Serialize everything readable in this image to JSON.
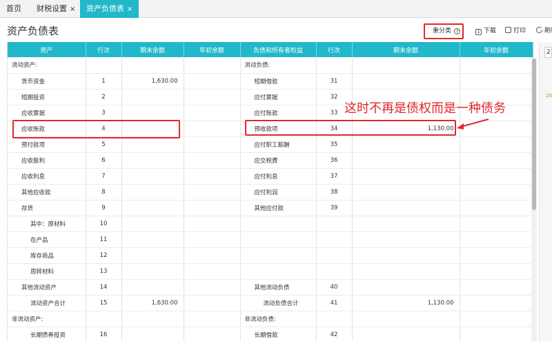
{
  "tabs": [
    {
      "label": "首页",
      "closable": false
    },
    {
      "label": "财税设置",
      "close": "×"
    },
    {
      "label": "资产负债表",
      "close": "×",
      "active": true
    }
  ],
  "page_title": "资产负债表",
  "toolbar": {
    "reclassify": "重分类",
    "help": "?",
    "download": "下载",
    "print": "打印",
    "refresh": "刷新"
  },
  "headers": [
    "资产",
    "行次",
    "期末余额",
    "年初余额",
    "负债和所有者权益",
    "行次",
    "期末余额",
    "年初余额"
  ],
  "rows": [
    {
      "a": "流动资产:",
      "al": "",
      "ae": "",
      "ab": "",
      "l": "流动负债:",
      "ll": "",
      "le": "",
      "lb": "",
      "ai": 0,
      "li": 0
    },
    {
      "a": "货币资金",
      "al": "1",
      "ae": "1,630.00",
      "ab": "",
      "l": "短期借款",
      "ll": "31",
      "le": "",
      "lb": "",
      "ai": 1,
      "li": 1
    },
    {
      "a": "短期投资",
      "al": "2",
      "ae": "",
      "ab": "",
      "l": "应付票据",
      "ll": "32",
      "le": "",
      "lb": "",
      "ai": 1,
      "li": 1
    },
    {
      "a": "应收票据",
      "al": "3",
      "ae": "",
      "ab": "",
      "l": "应付账款",
      "ll": "33",
      "le": "",
      "lb": "",
      "ai": 1,
      "li": 1
    },
    {
      "a": "应收账款",
      "al": "4",
      "ae": "",
      "ab": "",
      "l": "预收款项",
      "ll": "34",
      "le": "1,130.00",
      "lb": "",
      "ai": 1,
      "li": 1
    },
    {
      "a": "预付款项",
      "al": "5",
      "ae": "",
      "ab": "",
      "l": "应付职工薪酬",
      "ll": "35",
      "le": "",
      "lb": "",
      "ai": 1,
      "li": 1
    },
    {
      "a": "应收股利",
      "al": "6",
      "ae": "",
      "ab": "",
      "l": "应交税费",
      "ll": "36",
      "le": "",
      "lb": "",
      "ai": 1,
      "li": 1
    },
    {
      "a": "应收利息",
      "al": "7",
      "ae": "",
      "ab": "",
      "l": "应付利息",
      "ll": "37",
      "le": "",
      "lb": "",
      "ai": 1,
      "li": 1
    },
    {
      "a": "其他应收款",
      "al": "8",
      "ae": "",
      "ab": "",
      "l": "应付利润",
      "ll": "38",
      "le": "",
      "lb": "",
      "ai": 1,
      "li": 1
    },
    {
      "a": "存货",
      "al": "9",
      "ae": "",
      "ab": "",
      "l": "其他应付款",
      "ll": "39",
      "le": "",
      "lb": "",
      "ai": 1,
      "li": 1
    },
    {
      "a": "其中：原材料",
      "al": "10",
      "ae": "",
      "ab": "",
      "l": "",
      "ll": "",
      "le": "",
      "lb": "",
      "ai": 2,
      "li": 1
    },
    {
      "a": "在产品",
      "al": "11",
      "ae": "",
      "ab": "",
      "l": "",
      "ll": "",
      "le": "",
      "lb": "",
      "ai": 2,
      "li": 1
    },
    {
      "a": "库存商品",
      "al": "12",
      "ae": "",
      "ab": "",
      "l": "",
      "ll": "",
      "le": "",
      "lb": "",
      "ai": 2,
      "li": 1
    },
    {
      "a": "周转材料",
      "al": "13",
      "ae": "",
      "ab": "",
      "l": "",
      "ll": "",
      "le": "",
      "lb": "",
      "ai": 2,
      "li": 1
    },
    {
      "a": "其他流动资产",
      "al": "14",
      "ae": "",
      "ab": "",
      "l": "其他流动负债",
      "ll": "40",
      "le": "",
      "lb": "",
      "ai": 1,
      "li": 1
    },
    {
      "a": "流动资产合计",
      "al": "15",
      "ae": "1,630.00",
      "ab": "",
      "l": "流动负债合计",
      "ll": "41",
      "le": "1,130.00",
      "lb": "",
      "ai": 2,
      "li": 2
    },
    {
      "a": "非流动资产:",
      "al": "",
      "ae": "",
      "ab": "",
      "l": "非流动负债:",
      "ll": "",
      "le": "",
      "lb": "",
      "ai": 0,
      "li": 0
    },
    {
      "a": "长期债券投资",
      "al": "16",
      "ae": "",
      "ab": "",
      "l": "长期借款",
      "ll": "42",
      "le": "",
      "lb": "",
      "ai": 2,
      "li": 1
    }
  ],
  "annotation": "这时不再是债权而是一种债务",
  "side": {
    "box": "2",
    "green": "20"
  },
  "colors": {
    "header": "#21b8c9",
    "highlight": "#e0262a"
  }
}
